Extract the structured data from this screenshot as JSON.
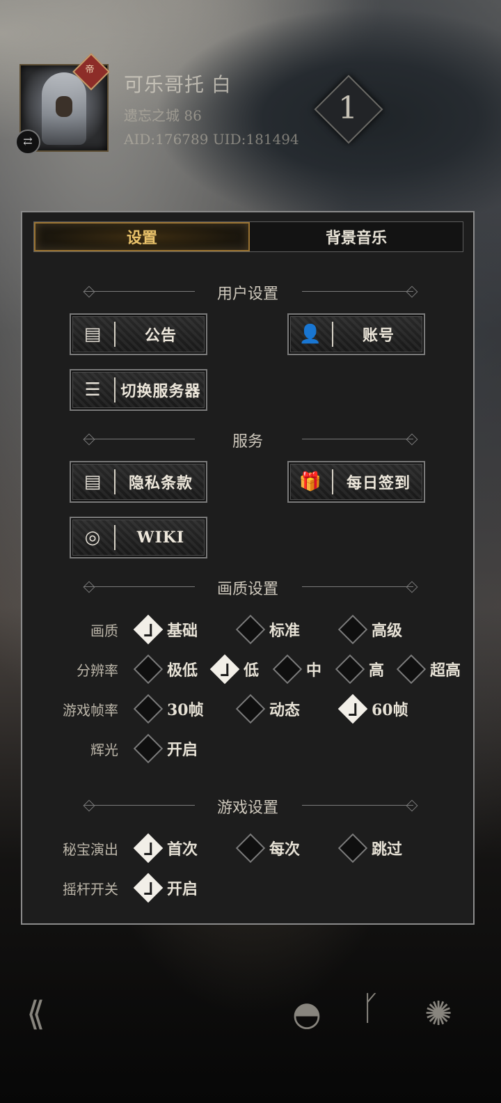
{
  "profile": {
    "name": "可乐哥托 白",
    "realm": "遗忘之城 86",
    "ids": "AID:176789 UID:181494",
    "level": "1",
    "badge": "帝"
  },
  "tabs": [
    {
      "label": "设置",
      "active": true
    },
    {
      "label": "背景音乐",
      "active": false
    }
  ],
  "sections": {
    "user": "用户设置",
    "service": "服务",
    "quality": "画质设置",
    "game": "游戏设置"
  },
  "buttons": {
    "notice": "公告",
    "account": "账号",
    "switch_server": "切换服务器",
    "privacy": "隐私条款",
    "daily_checkin": "每日签到",
    "wiki": "WIKI"
  },
  "quality_rows": [
    {
      "label": "画质",
      "options": [
        "基础",
        "标准",
        "高级"
      ],
      "selected": 0
    },
    {
      "label": "分辨率",
      "options": [
        "极低",
        "低",
        "中",
        "高",
        "超高"
      ],
      "selected": 1
    },
    {
      "label": "游戏帧率",
      "options": [
        "30帧",
        "动态",
        "60帧"
      ],
      "selected": 2
    },
    {
      "label": "辉光",
      "options": [
        "开启"
      ],
      "selected": -1
    }
  ],
  "game_rows": [
    {
      "label": "秘宝演出",
      "options": [
        "首次",
        "每次",
        "跳过"
      ],
      "selected": 0
    },
    {
      "label": "摇杆开关",
      "options": [
        "开启"
      ],
      "selected": 0
    }
  ],
  "icons": {
    "back": "back-arrow-icon",
    "helmet": "helmet-icon",
    "stance": "stance-icon",
    "beast": "beast-icon"
  }
}
